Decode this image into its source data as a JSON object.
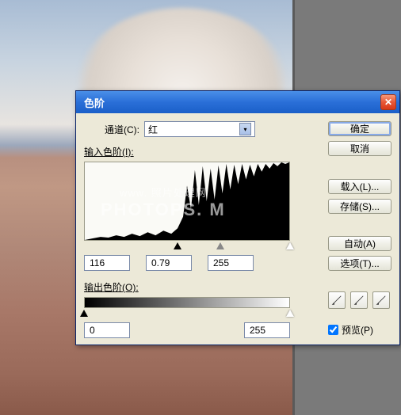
{
  "dialog": {
    "title": "色阶",
    "channel_label": "通道(C):",
    "channel_value": "红",
    "input_levels_label": "输入色阶(I):",
    "output_levels_label": "输出色阶(O):",
    "input_black": "116",
    "input_gamma": "0.79",
    "input_white": "255",
    "output_black": "0",
    "output_white": "255",
    "watermark_line1": "www.  照片处理网",
    "watermark_line2": "PHOTOPS.  M"
  },
  "buttons": {
    "ok": "确定",
    "cancel": "取消",
    "load": "载入(L)...",
    "save": "存储(S)...",
    "auto": "自动(A)",
    "options": "选项(T)..."
  },
  "preview": {
    "label": "预览(P)",
    "checked": true
  },
  "chart_data": {
    "type": "histogram",
    "title": "",
    "xlabel": "",
    "ylabel": "",
    "xlim": [
      0,
      255
    ],
    "description": "Red channel histogram: sparse low counts in shadows (0–110), dense spiky peaks in highlights (130–250) reaching full height, clipped at white.",
    "sliders": {
      "black": 116,
      "gamma": 0.79,
      "white": 255
    }
  }
}
